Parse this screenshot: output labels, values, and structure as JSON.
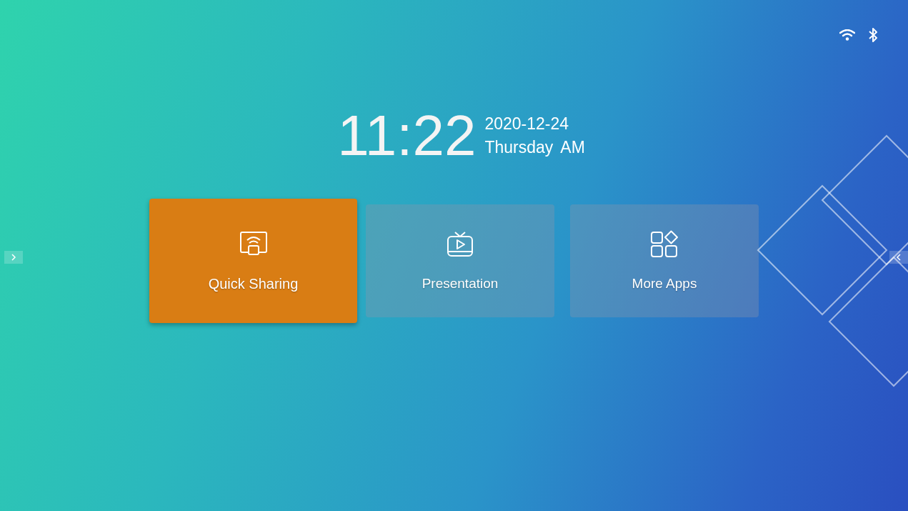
{
  "clock": {
    "time": "11:22",
    "date": "2020-12-24",
    "weekday": "Thursday",
    "period": "AM"
  },
  "tiles": [
    {
      "kind": "share",
      "label": "Quick Sharing",
      "selected": true
    },
    {
      "kind": "presentation",
      "label": "Presentation",
      "selected": false
    },
    {
      "kind": "apps",
      "label": "More Apps",
      "selected": false
    }
  ]
}
